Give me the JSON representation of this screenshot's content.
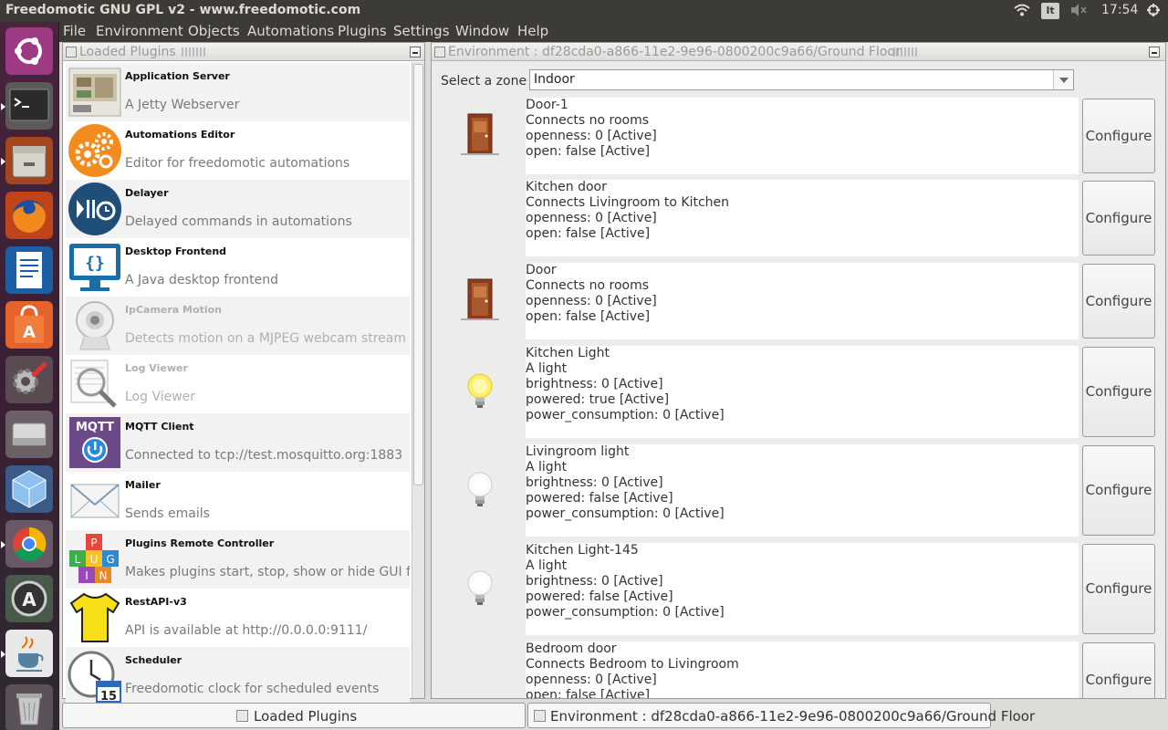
{
  "topbar": {
    "title": "Freedomotic GNU GPL v2 - www.freedomotic.com",
    "keyboard": "It",
    "time": "17:54"
  },
  "menu": [
    "File",
    "Environment",
    "Objects",
    "Automations",
    "Plugins",
    "Settings",
    "Window",
    "Help"
  ],
  "launcher": [
    "ubuntu-dash-icon",
    "terminal-icon",
    "files-icon",
    "firefox-icon",
    "writer-icon",
    "software-center-icon",
    "system-settings-icon",
    "disk-icon",
    "virtualbox-icon",
    "chrome-icon",
    "updater-icon",
    "java-icon",
    "trash-icon"
  ],
  "plugins_panel": {
    "title": "Loaded Plugins",
    "items": [
      {
        "name": "Application Server",
        "desc": "A Jetty Webserver",
        "icon": "application-server-icon",
        "enabled": true
      },
      {
        "name": "Automations Editor",
        "desc": "Editor for freedomotic automations",
        "icon": "gears-icon",
        "enabled": true
      },
      {
        "name": "Delayer",
        "desc": "Delayed commands in automations",
        "icon": "delayer-icon",
        "enabled": true
      },
      {
        "name": "Desktop Frontend",
        "desc": "A Java desktop frontend",
        "icon": "desktop-monitor-icon",
        "enabled": true
      },
      {
        "name": "IpCamera Motion",
        "desc": "Detects motion on a MJPEG webcam stream",
        "icon": "webcam-icon",
        "enabled": false
      },
      {
        "name": "Log Viewer",
        "desc": "Log Viewer",
        "icon": "magnifier-icon",
        "enabled": false
      },
      {
        "name": "MQTT Client",
        "desc": "Connected to tcp://test.mosquitto.org:1883",
        "icon": "mqtt-icon",
        "enabled": true
      },
      {
        "name": "Mailer",
        "desc": "Sends emails",
        "icon": "envelope-icon",
        "enabled": true
      },
      {
        "name": "Plugins Remote Controller",
        "desc": "Makes plugins start, stop, show or hide GUI fro",
        "icon": "plugin-blocks-icon",
        "enabled": true
      },
      {
        "name": "RestAPI-v3",
        "desc": "API is available at http://0.0.0.0:9111/",
        "icon": "tshirt-icon",
        "enabled": true
      },
      {
        "name": "Scheduler",
        "desc": "Freedomotic clock for scheduled events",
        "icon": "clock-calendar-icon",
        "enabled": true
      }
    ]
  },
  "env_panel": {
    "title": "Environment : df28cda0-a866-11e2-9e96-0800200c9a66/Ground Floor",
    "zone_label": "Select a zone",
    "zone_value": "Indoor",
    "configure_label": "Configure",
    "objects": [
      {
        "icon": "door-icon",
        "lines": [
          "Door-1",
          "Connects no rooms",
          "openness: 0 [Active]",
          "open: false [Active]"
        ]
      },
      {
        "icon": "",
        "lines": [
          "Kitchen door",
          "Connects Livingroom to Kitchen",
          "openness: 0 [Active]",
          "open: false [Active]"
        ]
      },
      {
        "icon": "door-icon",
        "lines": [
          "Door",
          "Connects no rooms",
          "openness: 0 [Active]",
          "open: false [Active]"
        ]
      },
      {
        "icon": "bulb-on-icon",
        "lines": [
          "Kitchen Light",
          "A light",
          "brightness: 0 [Active]",
          "powered: true [Active]",
          "power_consumption: 0 [Active]"
        ]
      },
      {
        "icon": "bulb-off-icon",
        "lines": [
          "Livingroom light",
          "A light",
          "brightness: 0 [Active]",
          "powered: false [Active]",
          "power_consumption: 0 [Active]"
        ]
      },
      {
        "icon": "bulb-off-icon",
        "lines": [
          "Kitchen Light-145",
          "A light",
          "brightness: 0 [Active]",
          "powered: false [Active]",
          "power_consumption: 0 [Active]"
        ]
      },
      {
        "icon": "",
        "lines": [
          "Bedroom door",
          "Connects Bedroom to Livingroom",
          "openness: 0 [Active]",
          "open: false [Active]"
        ]
      }
    ]
  },
  "taskbar": {
    "tab1": "Loaded Plugins",
    "tab2": "Environment : df28cda0-a866-11e2-9e96-0800200c9a66/Ground Floor"
  }
}
